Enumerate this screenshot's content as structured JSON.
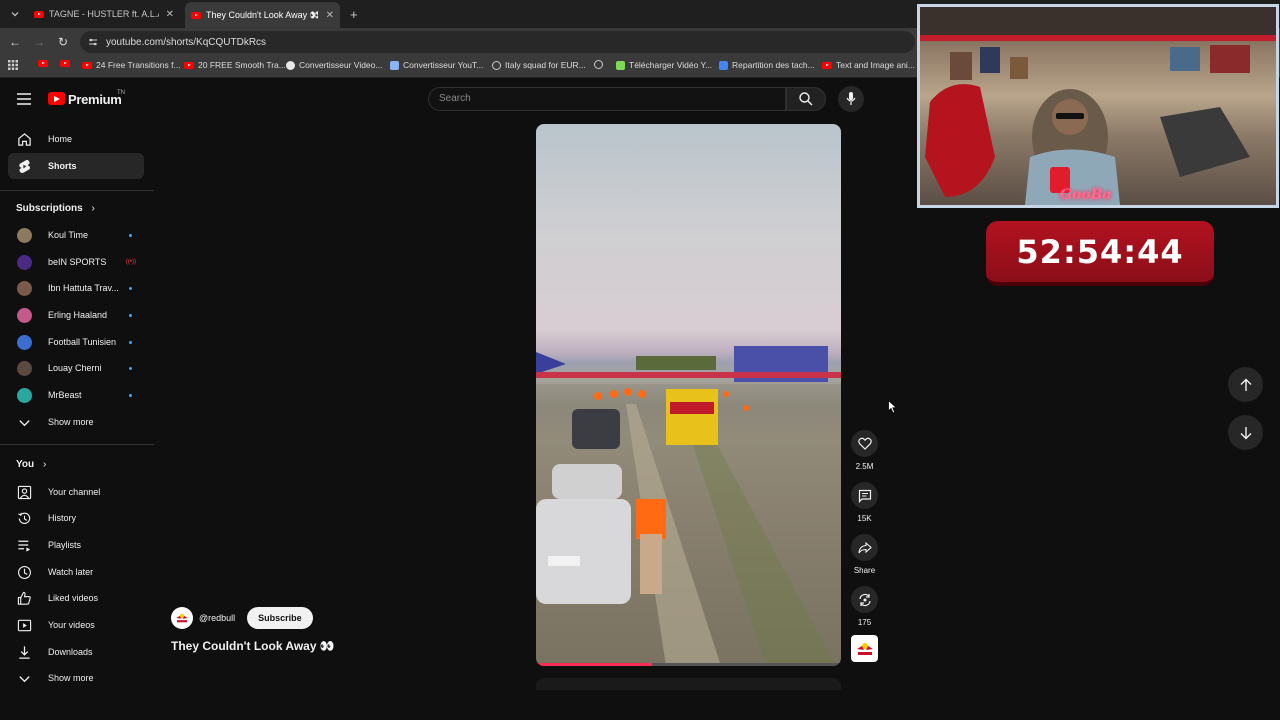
{
  "browser": {
    "tabs": [
      {
        "title": "TAGNE - HUSTLER ft. A.L.A (OFF",
        "active": false
      },
      {
        "title": "They Couldn't Look Away 👀 -",
        "active": true
      }
    ],
    "url": "youtube.com/shorts/KqCQUTDkRcs",
    "bookmarks": [
      "24 Free Transitions f...",
      "20 FREE Smooth Tra...",
      "Convertisseur Video...",
      "Convertisseur YouT...",
      "Italy squad for EUR...",
      "Télécharger Vidéo Y...",
      "Repartition des tach...",
      "Text and Image ani..."
    ]
  },
  "masthead": {
    "logo": "Premium",
    "logo_suffix": "TN",
    "search_placeholder": "Search"
  },
  "sidebar": {
    "main": [
      {
        "label": "Home",
        "icon": "home-icon",
        "active": false
      },
      {
        "label": "Shorts",
        "icon": "shorts-icon",
        "active": true
      }
    ],
    "subscriptions_heading": "Subscriptions",
    "subscriptions": [
      {
        "label": "Koul Time",
        "status": "new"
      },
      {
        "label": "beIN SPORTS",
        "status": "live"
      },
      {
        "label": "Ibn Hattuta Trav...",
        "status": "new"
      },
      {
        "label": "Erling Haaland",
        "status": "new"
      },
      {
        "label": "Football Tunisien",
        "status": "new"
      },
      {
        "label": "Louay Cherni",
        "status": "new"
      },
      {
        "label": "MrBeast",
        "status": "new"
      }
    ],
    "subs_show_more": "Show more",
    "you_heading": "You",
    "you_items": [
      {
        "label": "Your channel",
        "icon": "channel-icon"
      },
      {
        "label": "History",
        "icon": "history-icon"
      },
      {
        "label": "Playlists",
        "icon": "playlists-icon"
      },
      {
        "label": "Watch later",
        "icon": "watch-later-icon"
      },
      {
        "label": "Liked videos",
        "icon": "like-icon"
      },
      {
        "label": "Your videos",
        "icon": "your-videos-icon"
      },
      {
        "label": "Downloads",
        "icon": "download-icon"
      }
    ],
    "you_show_more": "Show more"
  },
  "short": {
    "channel_handle": "@redbull",
    "subscribe_label": "Subscribe",
    "title": "They Couldn't Look Away 👀",
    "likes": "2.5M",
    "comments": "15K",
    "share_label": "Share",
    "remixes": "175",
    "progress": 0.38
  },
  "overlay": {
    "webcam_name": "GooBa",
    "timer": "52:54:44"
  },
  "colors": {
    "accent": "#ff0000",
    "timer_bg": "#b3121f",
    "background": "#0f0f0f"
  }
}
